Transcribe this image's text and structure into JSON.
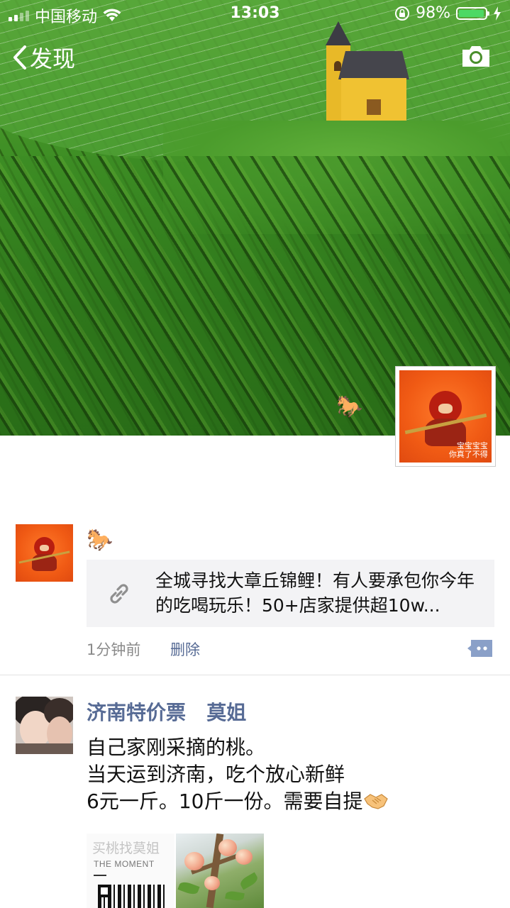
{
  "status_bar": {
    "carrier": "中国移动",
    "time": "13:03",
    "battery": "98%",
    "battery_level": 0.98
  },
  "nav": {
    "back_label": "发现",
    "camera_icon": "camera-icon"
  },
  "profile": {
    "avatar_caption_line1": "宝宝宝宝",
    "avatar_caption_line2": "你真了不得"
  },
  "posts": [
    {
      "emoji": "🐎",
      "link_title": "全城寻找大章丘锦鲤！有人要承包你今年的吃喝玩乐！50+店家提供超10w...",
      "time": "1分钟前",
      "delete_label": "删除"
    },
    {
      "author": "济南特价票   莫姐",
      "lines": [
        "自己家刚采摘的桃。",
        "当天运到济南，吃个放心新鲜",
        "6元一斤。10斤一份。需要自提"
      ],
      "images": [
        {
          "text1": "买桃找莫姐",
          "text2": "THE MOMENT"
        },
        {
          "description": "peach-tree-photo"
        }
      ]
    }
  ],
  "colors": {
    "link_blue": "#576b95",
    "battery_green": "#4cd964",
    "divider": "#e2e2e2"
  }
}
